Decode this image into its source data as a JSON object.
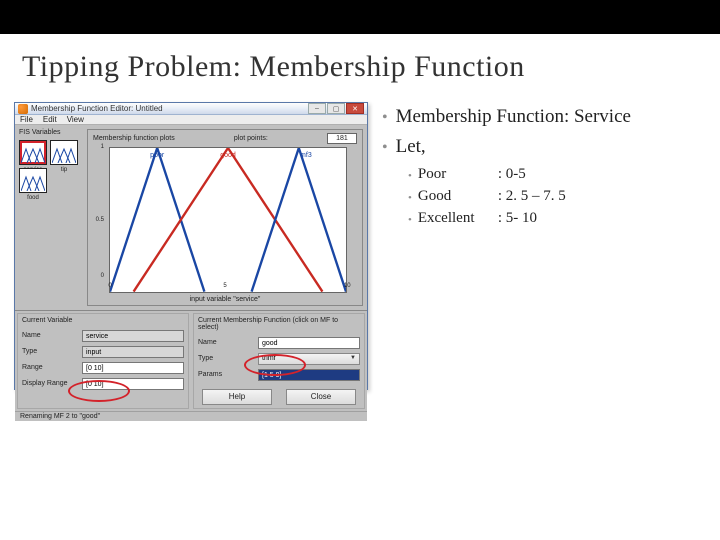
{
  "slide": {
    "title": "Tipping Problem: Membership Function"
  },
  "bullets": {
    "b1": "Membership Function: Service",
    "b2": "Let,",
    "sub": [
      {
        "term": "Poor",
        "range": ": 0-5"
      },
      {
        "term": "Good",
        "range": ": 2. 5 – 7. 5"
      },
      {
        "term": "Excellent",
        "range": ": 5- 10"
      }
    ]
  },
  "editor": {
    "window_title": "Membership Function Editor: Untitled",
    "menus": {
      "file": "File",
      "edit": "Edit",
      "view": "View"
    },
    "fis_label": "FIS Variables",
    "vars": {
      "service": "service",
      "tip": "tip",
      "food": "food"
    },
    "plot": {
      "header": "Membership function plots",
      "points_label": "plot points:",
      "points_value": "181",
      "mf1": "poor",
      "mf2": "good",
      "mf3": "mf3",
      "xlabel": "input variable \"service\""
    },
    "left_panel": {
      "head": "Current Variable",
      "name_lbl": "Name",
      "name_val": "service",
      "type_lbl": "Type",
      "type_val": "input",
      "range_lbl": "Range",
      "range_val": "[0 10]",
      "drange_lbl": "Display Range",
      "drange_val": "[0 10]"
    },
    "right_panel": {
      "head": "Current Membership Function (click on MF to select)",
      "name_lbl": "Name",
      "name_val": "good",
      "type_lbl": "Type",
      "type_val": "trimf",
      "params_lbl": "Params",
      "params_val": "[1 5 9]"
    },
    "buttons": {
      "help": "Help",
      "close": "Close"
    },
    "status": "Renaming MF 2 to \"good\""
  },
  "chart_data": {
    "type": "line",
    "title": "Membership function plots",
    "xlabel": "input variable \"service\"",
    "ylabel": "",
    "xlim": [
      0,
      10
    ],
    "ylim": [
      0,
      1
    ],
    "xticks": [
      0,
      1,
      2,
      3,
      4,
      5,
      6,
      7,
      8,
      9,
      10
    ],
    "yticks": [
      0,
      0.5,
      1
    ],
    "series": [
      {
        "name": "poor",
        "x": [
          0,
          2,
          4
        ],
        "y": [
          0,
          1,
          0
        ]
      },
      {
        "name": "good",
        "x": [
          1,
          5,
          9
        ],
        "y": [
          0,
          1,
          0
        ],
        "selected": true
      },
      {
        "name": "mf3",
        "x": [
          6,
          8,
          10
        ],
        "y": [
          0,
          1,
          0
        ]
      }
    ]
  }
}
